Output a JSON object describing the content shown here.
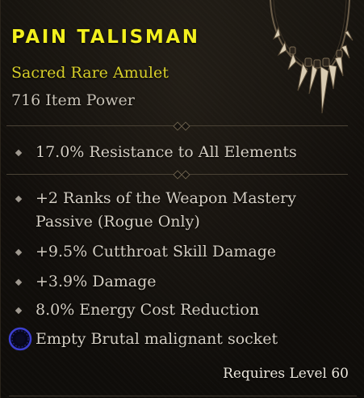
{
  "item": {
    "name": "PAIN TALISMAN",
    "type": "Sacred Rare Amulet",
    "item_power": "716 Item Power",
    "implicit": "17.0% Resistance to All Elements",
    "affixes": [
      "+2 Ranks of the Weapon Mastery",
      "Passive (Rogue Only)",
      "+9.5% Cutthroat Skill Damage",
      "+3.9% Damage",
      "8.0% Energy Cost Reduction"
    ],
    "socket": "Empty Brutal malignant socket",
    "requirement": "Requires Level 60"
  },
  "colors": {
    "name": "#f2ef1e",
    "rarity": "#d8cf2a",
    "text": "#d3cdc2",
    "socket": "#3c3fd0"
  },
  "icons": {
    "item": "fang-amulet-icon",
    "bullet": "diamond-bullet-icon",
    "socket": "malignant-socket-icon"
  }
}
